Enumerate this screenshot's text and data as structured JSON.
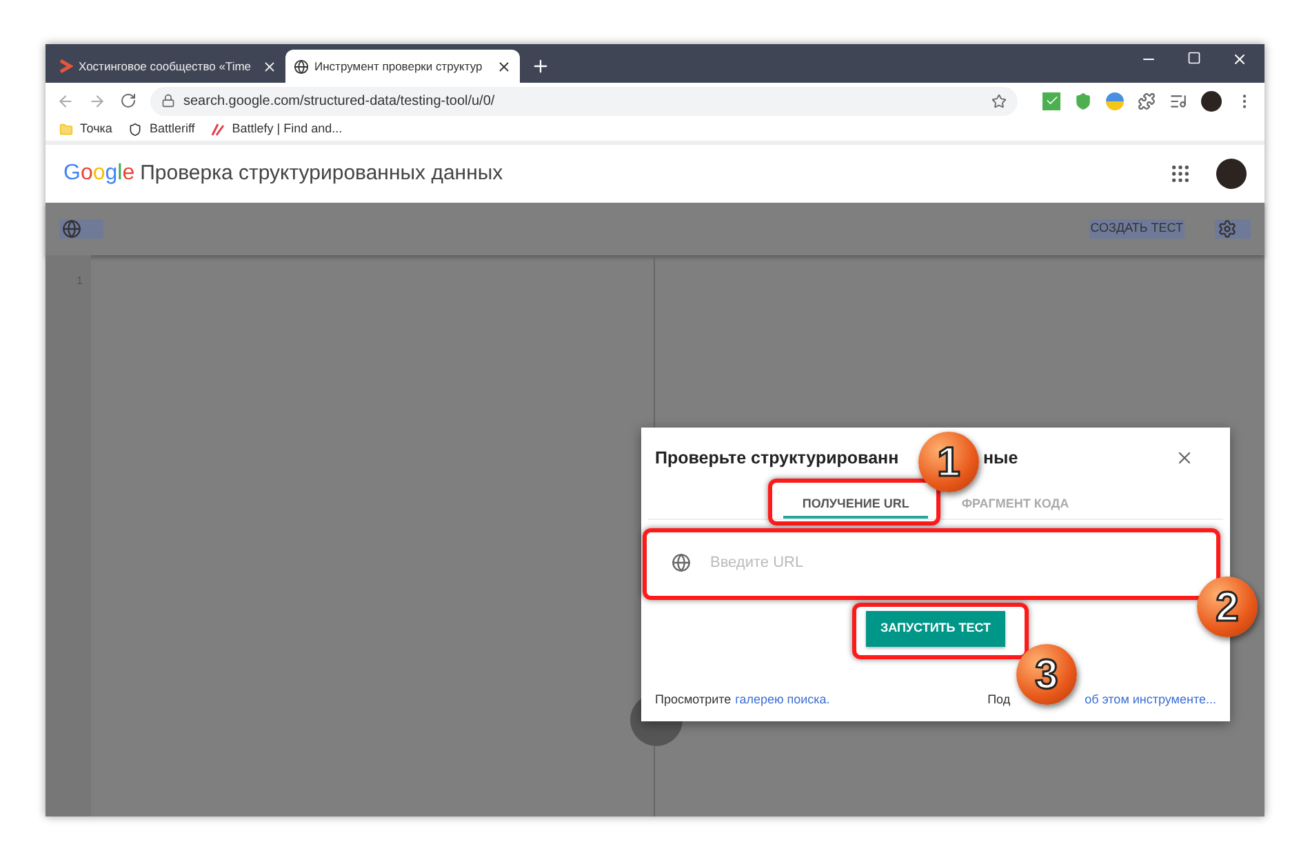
{
  "browser": {
    "tabs": [
      {
        "title": "Хостинговое сообщество «Time",
        "selected": false
      },
      {
        "title": "Инструмент проверки структур",
        "selected": true
      }
    ],
    "url": "search.google.com/structured-data/testing-tool/u/0/",
    "bookmarks": [
      "Точка",
      "Battleriff",
      "Battlefy | Find and..."
    ]
  },
  "app": {
    "logo": "Google",
    "title": "Проверка структурированных данных",
    "create_test": "СОЗДАТЬ ТЕСТ",
    "line_number": "1"
  },
  "dialog": {
    "title_parts": [
      "Проверьте структурированн",
      "ные"
    ],
    "tabs": [
      {
        "label": "ПОЛУЧЕНИЕ URL",
        "selected": true
      },
      {
        "label": "ФРАГМЕНТ КОДА",
        "selected": false
      }
    ],
    "url_placeholder": "Введите URL",
    "run_button": "ЗАПУСТИТЬ ТЕСТ",
    "footer_left": {
      "text": "Просмотрите",
      "link": "галерею поиска."
    },
    "footer_right": {
      "text": "Под",
      "link": "об этом инструменте..."
    }
  },
  "annotations": [
    {
      "label": "1"
    },
    {
      "label": "2"
    },
    {
      "label": "3"
    }
  ]
}
